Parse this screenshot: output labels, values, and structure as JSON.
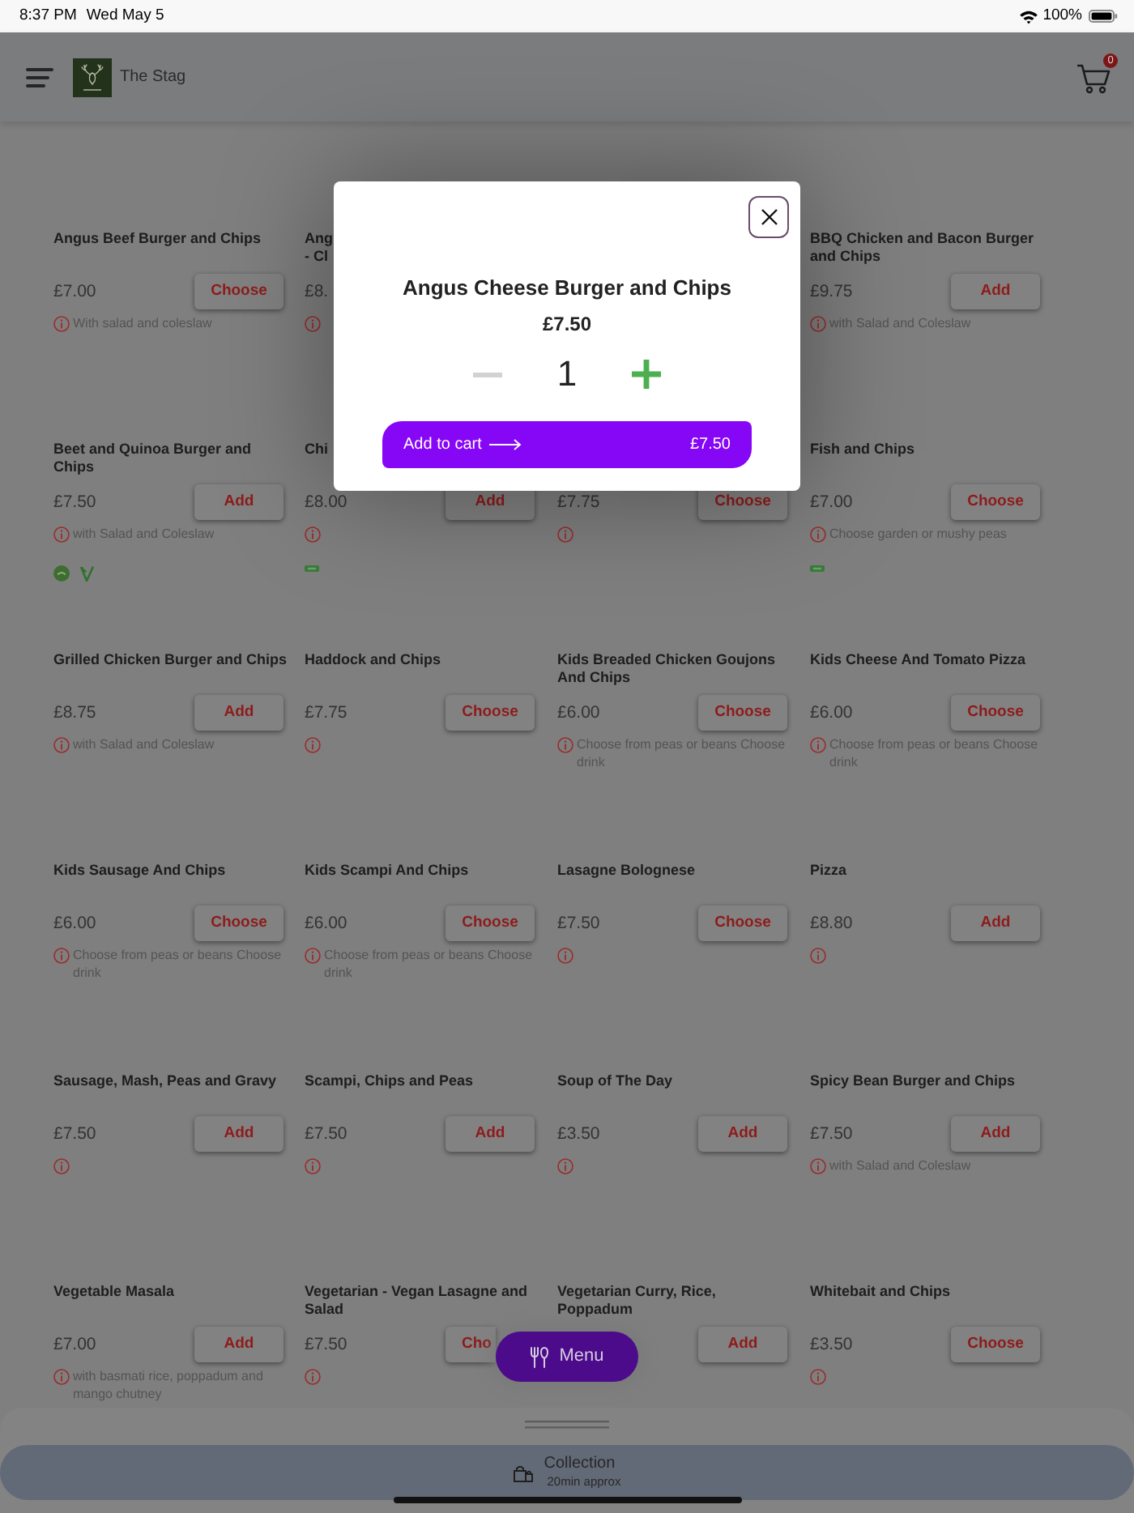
{
  "status_bar": {
    "time": "8:37 PM",
    "date": "Wed May 5",
    "battery": "100%"
  },
  "header": {
    "restaurant": "The Stag",
    "cart_count": "0"
  },
  "menu_rows": [
    {
      "cells": [
        {
          "title": "Angus Beef Burger and Chips",
          "price": "£7.00",
          "button": {
            "label": "Choose",
            "covered": false
          },
          "info_icon": true,
          "note": "With salad and coleslaw"
        },
        {
          "title_lines": [
            "Ang",
            "- Cl"
          ],
          "price": "£8.",
          "info_icon": true
        },
        null,
        {
          "title": "BBQ Chicken and Bacon Burger and Chips",
          "price": "£9.75",
          "button": {
            "label": "Add",
            "covered": false
          },
          "info_icon": true,
          "note": "with Salad and Coleslaw"
        }
      ]
    },
    {
      "cells": [
        {
          "title": "Beet and Quinoa Burger and Chips",
          "price": "£7.50",
          "button": {
            "label": "Add",
            "covered": false
          },
          "info_icon": true,
          "note": "with Salad and Coleslaw",
          "badges": [
            {
              "kind": "disc"
            },
            {
              "kind": "sprout"
            }
          ]
        },
        {
          "title": "Chi",
          "price": "£8.00",
          "button": {
            "label": "Add",
            "covered": false
          },
          "info_icon": true,
          "badges": [
            {
              "kind": "tag"
            }
          ]
        },
        {
          "price": "£7.75",
          "button": {
            "label": "Choose",
            "covered": false
          },
          "info_icon": true
        },
        {
          "title": "Fish and Chips",
          "price": "£7.00",
          "button": {
            "label": "Choose",
            "covered": false
          },
          "info_icon": true,
          "note": "Choose garden or mushy peas",
          "badges": [
            {
              "kind": "tag"
            }
          ]
        }
      ]
    },
    {
      "cells": [
        {
          "title": "Grilled Chicken Burger and Chips",
          "price": "£8.75",
          "button": {
            "label": "Add",
            "covered": false
          },
          "info_icon": true,
          "note": "with Salad and Coleslaw"
        },
        {
          "title": "Haddock and Chips",
          "price": "£7.75",
          "button": {
            "label": "Choose",
            "covered": false
          },
          "info_icon": true
        },
        {
          "title": "Kids Breaded Chicken Goujons And Chips",
          "price": "£6.00",
          "button": {
            "label": "Choose",
            "covered": false
          },
          "info_icon": true,
          "note": "Choose from peas or beans Choose drink"
        },
        {
          "title": "Kids Cheese And Tomato Pizza",
          "price": "£6.00",
          "button": {
            "label": "Choose",
            "covered": false
          },
          "info_icon": true,
          "note": "Choose from peas or beans Choose drink"
        }
      ]
    },
    {
      "cells": [
        {
          "title": "Kids Sausage And Chips",
          "price": "£6.00",
          "button": {
            "label": "Choose",
            "covered": false
          },
          "info_icon": true,
          "note": "Choose from peas or beans Choose drink"
        },
        {
          "title": "Kids Scampi And Chips",
          "price": "£6.00",
          "button": {
            "label": "Choose",
            "covered": false
          },
          "info_icon": true,
          "note": "Choose from peas or beans Choose drink"
        },
        {
          "title": "Lasagne Bolognese",
          "price": "£7.50",
          "button": {
            "label": "Choose",
            "covered": false
          },
          "info_icon": true
        },
        {
          "title": "Pizza",
          "price": "£8.80",
          "button": {
            "label": "Add",
            "covered": false
          },
          "info_icon": true
        }
      ]
    },
    {
      "cells": [
        {
          "title": "Sausage, Mash, Peas and Gravy",
          "price": "£7.50",
          "button": {
            "label": "Add",
            "covered": false
          },
          "info_icon": true
        },
        {
          "title": "Scampi, Chips and Peas",
          "price": "£7.50",
          "button": {
            "label": "Add",
            "covered": false
          },
          "info_icon": true
        },
        {
          "title": "Soup of The Day",
          "price": "£3.50",
          "button": {
            "label": "Add",
            "covered": false
          },
          "info_icon": true
        },
        {
          "title": "Spicy Bean Burger and Chips",
          "price": "£7.50",
          "button": {
            "label": "Add",
            "covered": false
          },
          "info_icon": true,
          "note": "with Salad and Coleslaw"
        }
      ]
    },
    {
      "cells": [
        {
          "title": "Vegetable Masala",
          "price": "£7.00",
          "button": {
            "label": "Add",
            "covered": false
          },
          "info_icon": true,
          "note": "with basmati rice, poppadum and mango chutney"
        },
        {
          "title": "Vegetarian - Vegan Lasagne and Salad",
          "price": "£7.50",
          "button": {
            "label": "Cho",
            "covered": true
          },
          "info_icon": true
        },
        {
          "title": "Vegetarian Curry, Rice, Poppadum",
          "button": {
            "label": "Add",
            "covered": false
          },
          "info_icon": false
        },
        {
          "title": "Whitebait and Chips",
          "price": "£3.50",
          "button": {
            "label": "Choose",
            "covered": false
          },
          "info_icon": true
        }
      ]
    }
  ],
  "modal": {
    "title": "Angus Cheese Burger and Chips",
    "price": "£7.50",
    "quantity": "1",
    "add_button": {
      "label": "Add to cart",
      "price": "£7.50"
    }
  },
  "menu_button": {
    "label": "Menu"
  },
  "order_bar": {
    "mode": "Collection",
    "time": "20min approx"
  }
}
